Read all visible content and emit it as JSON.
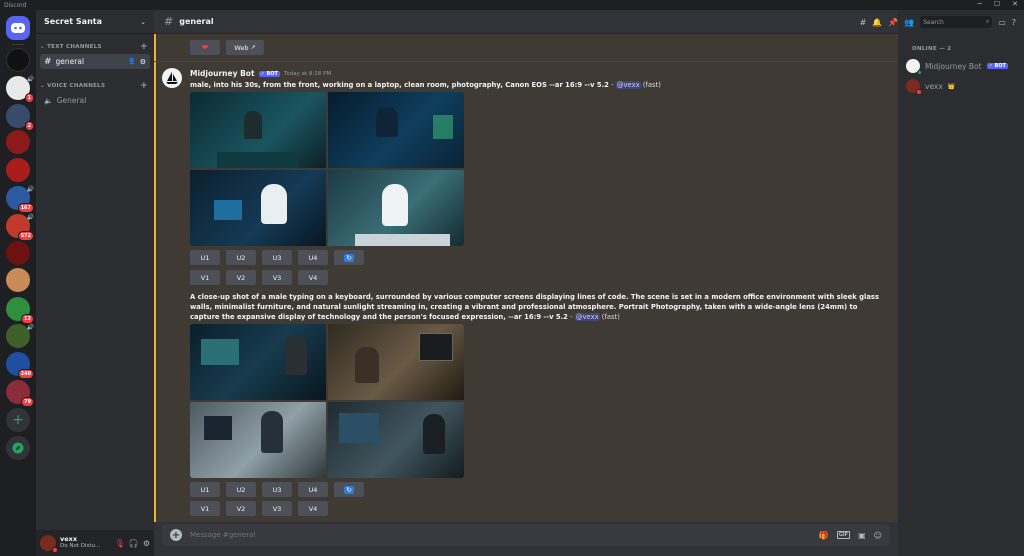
{
  "window": {
    "title": "Discord"
  },
  "server": {
    "name": "Secret Santa"
  },
  "rail": {
    "servers": [
      {
        "name": "discord-home",
        "badge": "",
        "color": "#5865f2"
      },
      {
        "name": "server-dark",
        "badge": "",
        "color": "#111"
      },
      {
        "name": "server-2",
        "badge": "1",
        "color": "#e9e9e9"
      },
      {
        "name": "server-3",
        "badge": "2",
        "color": "#3a4a6b"
      },
      {
        "name": "server-4",
        "badge": "",
        "color": "#8b1a1a"
      },
      {
        "name": "server-5",
        "badge": "",
        "color": "#a81c1c"
      },
      {
        "name": "server-6",
        "badge": "167",
        "color": "#2c5aa0"
      },
      {
        "name": "server-7",
        "badge": "572",
        "color": "#c03a2b"
      },
      {
        "name": "server-8",
        "badge": "",
        "color": "#6e1111"
      },
      {
        "name": "server-9",
        "badge": "",
        "color": "#c98a5a"
      },
      {
        "name": "server-10",
        "badge": "12",
        "color": "#2f8f3a"
      },
      {
        "name": "server-11",
        "badge": "",
        "color": "#3f5f2a"
      },
      {
        "name": "server-12",
        "badge": "240",
        "color": "#1f4fa0"
      },
      {
        "name": "server-13",
        "badge": "79",
        "color": "#8a2c3a"
      }
    ]
  },
  "channels": {
    "text_category": "TEXT CHANNELS",
    "text": [
      {
        "name": "general"
      }
    ],
    "voice_category": "VOICE CHANNELS",
    "voice": [
      {
        "name": "General"
      }
    ]
  },
  "user": {
    "name": "vexx",
    "status": "Do Not Distu..."
  },
  "topbar": {
    "channel": "general"
  },
  "top_buttons": {
    "heart": "❤",
    "web": "Web"
  },
  "message": {
    "author": "Midjourney Bot",
    "bot_tag": "BOT",
    "timestamp": "Today at 8:18 PM",
    "prompt1": "male, into his 30s, from the front, working on a laptop, clean room, photography, Canon EOS --ar 16:9 --v 5.2",
    "mention": "@vexx",
    "speed": "(fast)",
    "prompt2": "A close-up shot of a male typing on a keyboard, surrounded by various computer screens displaying lines of code. The scene is set in a modern office environment with sleek glass walls, minimalist furniture, and natural sunlight streaming in, creating a vibrant and professional atmosphere. Portrait Photography, taken with a wide-angle lens (24mm) to capture the expansive display of technology and the person's focused expression, --ar 16:9 --v 5.2",
    "upscale": [
      "U1",
      "U2",
      "U3",
      "U4"
    ],
    "variation": [
      "V1",
      "V2",
      "V3",
      "V4"
    ]
  },
  "composer": {
    "placeholder": "Message #general"
  },
  "members": {
    "search_placeholder": "Search",
    "online_header": "ONLINE — 2",
    "list": [
      {
        "name": "Midjourney Bot",
        "bot": "BOT"
      },
      {
        "name": "vexx",
        "crown": "👑"
      }
    ]
  }
}
